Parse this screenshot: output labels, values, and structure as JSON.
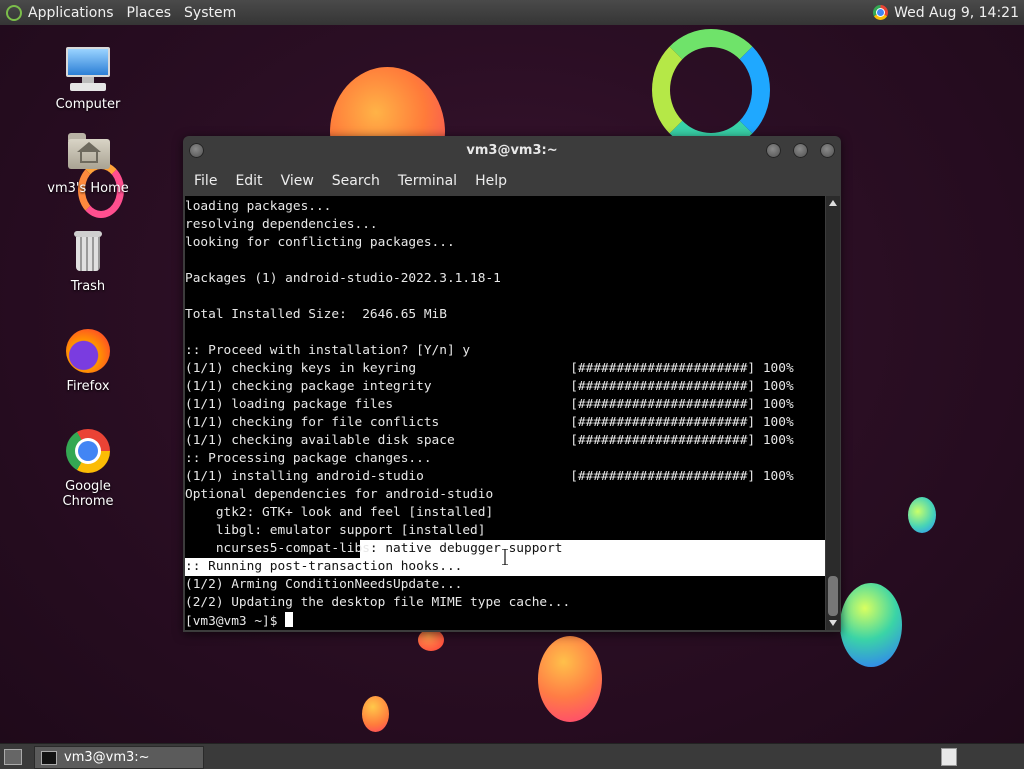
{
  "top_panel": {
    "menus": [
      "Applications",
      "Places",
      "System"
    ],
    "clock": "Wed Aug  9, 14:21"
  },
  "desktop_icons": [
    {
      "label": "Computer",
      "icon": "computer-icon"
    },
    {
      "label": "vm3's Home",
      "icon": "home-folder-icon"
    },
    {
      "label": "Trash",
      "icon": "trash-icon"
    },
    {
      "label": "Firefox",
      "icon": "firefox-icon"
    },
    {
      "label": "Google Chrome",
      "icon": "chrome-icon"
    }
  ],
  "terminal": {
    "title": "vm3@vm3:~",
    "menu": [
      "File",
      "Edit",
      "View",
      "Search",
      "Terminal",
      "Help"
    ],
    "lines": [
      "loading packages...",
      "resolving dependencies...",
      "looking for conflicting packages...",
      "",
      "Packages (1) android-studio-2022.3.1.18-1",
      "",
      "Total Installed Size:  2646.65 MiB",
      "",
      ":: Proceed with installation? [Y/n] y",
      "(1/1) checking keys in keyring                    [######################] 100%",
      "(1/1) checking package integrity                  [######################] 100%",
      "(1/1) loading package files                       [######################] 100%",
      "(1/1) checking for file conflicts                 [######################] 100%",
      "(1/1) checking available disk space               [######################] 100%",
      ":: Processing package changes...",
      "(1/1) installing android-studio                   [######################] 100%",
      "Optional dependencies for android-studio",
      "    gtk2: GTK+ look and feel [installed]",
      "    libgl: emulator support [installed]",
      "    ncurses5-compat-libs: native debugger support",
      ":: Running post-transaction hooks...",
      "(1/2) Arming ConditionNeedsUpdate...",
      "(2/2) Updating the desktop file MIME type cache...",
      "[vm3@vm3 ~]$ "
    ]
  },
  "taskbar": {
    "task_label": "vm3@vm3:~"
  },
  "colors": {
    "panel": "#3a3a3a",
    "terminal_bg": "#000000",
    "terminal_fg": "#e8e8e8",
    "selection": "#ffffff"
  }
}
